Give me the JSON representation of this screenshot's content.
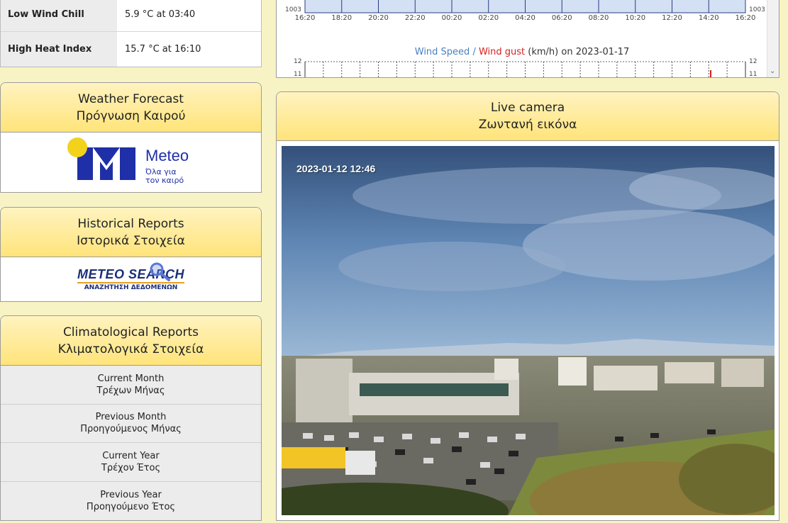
{
  "records": [
    {
      "label": "Low Wind Chill",
      "value": "5.9 °C at 03:40"
    },
    {
      "label": "High Heat Index",
      "value": "15.7 °C at 16:10"
    }
  ],
  "forecast": {
    "title_en": "Weather Forecast",
    "title_gr": "Πρόγνωση Καιρού",
    "logo_name": "Meteo",
    "logo_tagline_1": "Όλα για",
    "logo_tagline_2": "τον καιρό"
  },
  "historical": {
    "title_en": "Historical Reports",
    "title_gr": "Ιστορικά Στοιχεία",
    "logo_text": "METEO SEARCH",
    "logo_sub": "ΑΝΑΖΗΤΗΣΗ ΔΕΔΟΜΕΝΩΝ"
  },
  "climatological": {
    "title_en": "Climatological Reports",
    "title_gr": "Κλιματολογικά Στοιχεία",
    "items": [
      {
        "en": "Current Month",
        "gr": "Τρέχων Μήνας"
      },
      {
        "en": "Previous Month",
        "gr": "Προηγούμενος Μήνας"
      },
      {
        "en": "Current Year",
        "gr": "Τρέχον Έτος"
      },
      {
        "en": "Previous Year",
        "gr": "Προηγούμενο Έτος"
      }
    ]
  },
  "pressure_chart": {
    "y_label_left": "1003",
    "y_label_right": "1003",
    "times": [
      "16:20",
      "18:20",
      "20:20",
      "22:20",
      "00:20",
      "02:20",
      "04:20",
      "06:20",
      "08:20",
      "10:20",
      "12:20",
      "14:20",
      "16:20"
    ]
  },
  "wind_chart": {
    "title_speed": "Wind Speed",
    "title_sep": " / ",
    "title_gust": "Wind gust",
    "title_unit": " (km/h) on ",
    "title_date": "2023-01-17",
    "y_top": "12",
    "y_next": "11",
    "speed_color": "#4a7fc0",
    "gust_color": "#d42020"
  },
  "camera": {
    "title_en": "Live camera",
    "title_gr": "Ζωντανή εικόνα",
    "timestamp": "2023-01-12 12:46"
  }
}
